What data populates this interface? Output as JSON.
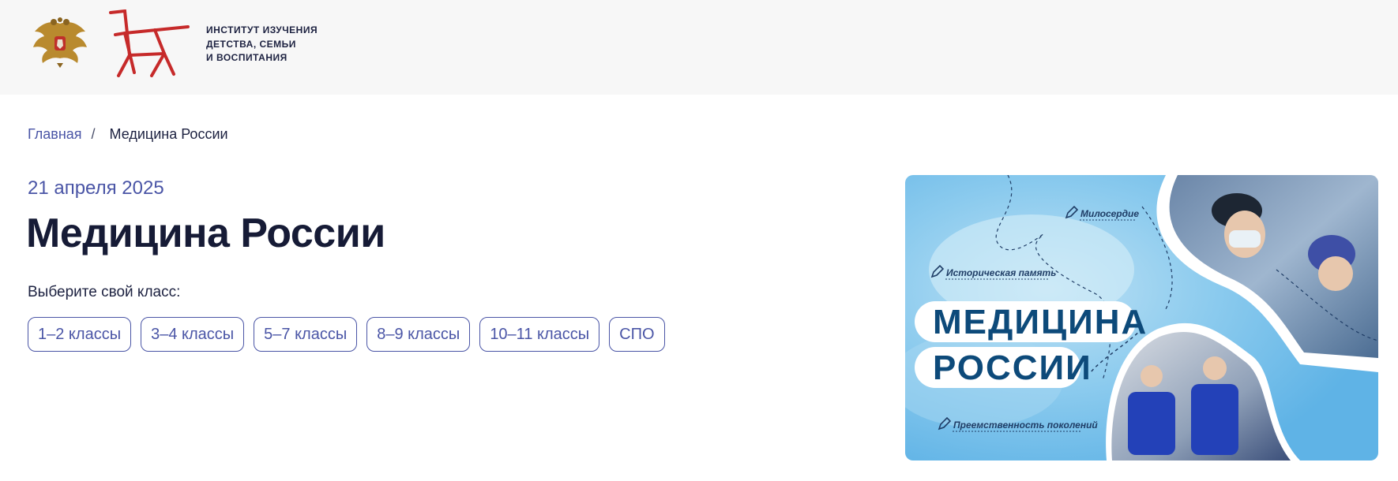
{
  "header": {
    "institute_line1": "ИНСТИТУТ ИЗУЧЕНИЯ",
    "institute_line2": "ДЕТСТВА, СЕМЬИ",
    "institute_line3": "И ВОСПИТАНИЯ"
  },
  "breadcrumb": {
    "home": "Главная",
    "separator": "/",
    "current": "Медицина России"
  },
  "article": {
    "date": "21 апреля 2025",
    "title": "Медицина России",
    "choose_class": "Выберите свой класс:"
  },
  "grades": [
    "1–2 классы",
    "3–4 классы",
    "5–7 классы",
    "8–9 классы",
    "10–11 классы",
    "СПО"
  ],
  "banner": {
    "tag1": "Милосердие",
    "tag2": "Историческая память",
    "tag3": "Преемственность поколений",
    "title_line1": "МЕДИЦИНА",
    "title_line2": "РОССИИ"
  },
  "colors": {
    "accent": "#4a55a6",
    "title": "#161b36",
    "header_bg": "#f7f7f7",
    "logo_red": "#c62a2a",
    "banner_title": "#0d4a7a"
  }
}
